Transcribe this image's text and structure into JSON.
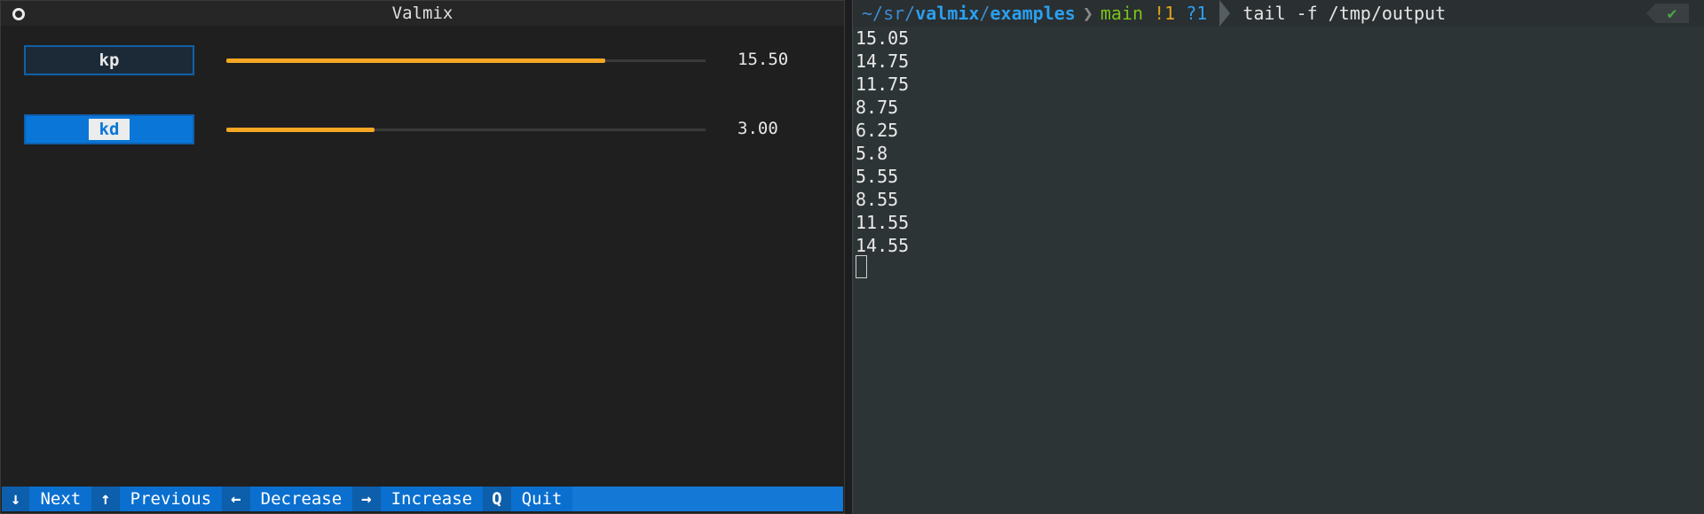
{
  "left": {
    "title": "Valmix",
    "sliders": [
      {
        "label": "kp",
        "value_text": "15.50",
        "fraction": 0.79
      },
      {
        "label": "kd",
        "value_text": "3.00",
        "fraction": 0.31
      }
    ],
    "statusbar": [
      {
        "key": "↓",
        "action": "Next"
      },
      {
        "key": "↑",
        "action": "Previous"
      },
      {
        "key": "←",
        "action": "Decrease"
      },
      {
        "key": "→",
        "action": "Increase"
      },
      {
        "key": "Q",
        "action": "Quit"
      }
    ]
  },
  "right": {
    "prompt": {
      "path_prefix": "~/sr/",
      "path_bold1": "valmix",
      "path_sep": "/",
      "path_bold2": "examples",
      "branch": "main",
      "modified": "!1",
      "untracked": "?1",
      "command": "tail -f /tmp/output",
      "status_icon": "check-icon"
    },
    "output_lines": [
      "15.05",
      "14.75",
      "11.75",
      "8.75",
      "6.25",
      "5.8",
      "5.55",
      "8.55",
      "11.55",
      "14.55"
    ]
  },
  "colors": {
    "accent_blue": "#1479d6",
    "slider_fill": "#f5a623",
    "git_branch": "#79c41a",
    "git_modified": "#e0a318"
  }
}
